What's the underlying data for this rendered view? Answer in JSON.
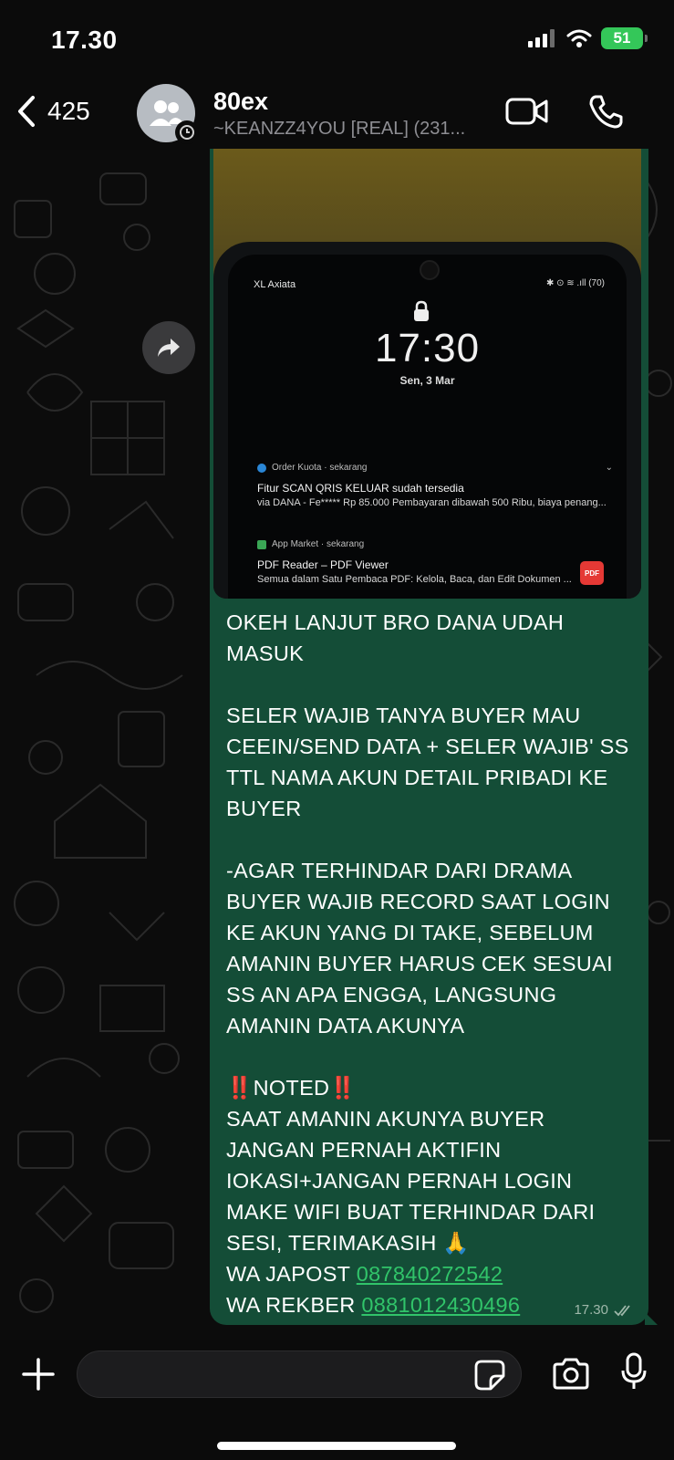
{
  "status_bar": {
    "time": "17.30",
    "battery": "51",
    "icons": [
      "signal-icon",
      "wifi-icon",
      "battery-icon"
    ]
  },
  "header": {
    "back_count": "425",
    "title": "80ex",
    "subtitle": "~KEANZZ4YOU [REAL] (231...",
    "icons": [
      "back-chevron-icon",
      "group-avatar-icon",
      "video-call-icon",
      "phone-call-icon"
    ]
  },
  "message": {
    "image": {
      "carrier": "XL Axiata",
      "status": "✱ ⊙ ≋ .ıll (70)",
      "lock_time": "17:30",
      "lock_date": "Sen, 3 Mar",
      "notifications": [
        {
          "app": "Order Kuota · sekarang",
          "title": "Fitur SCAN QRIS KELUAR sudah tersedia",
          "body": "via DANA - Fe***** Rp 85.000 Pembayaran dibawah 500 Ribu, biaya penang...",
          "color": "#2a86d6"
        },
        {
          "app": "App Market · sekarang",
          "title": "PDF Reader – PDF Viewer",
          "body": "Semua dalam Satu Pembaca PDF: Kelola, Baca, dan Edit Dokumen ...",
          "color": "#3aa655",
          "badge": "PDF"
        }
      ]
    },
    "text": {
      "p1": "OKEH LANJUT BRO DANA UDAH MASUK",
      "p2": "SELER WAJIB TANYA BUYER MAU CEEIN/SEND DATA + SELER WAJIB' SS TTL NAMA AKUN DETAIL PRIBADI KE BUYER",
      "p3": "-AGAR TERHINDAR DARI DRAMA BUYER WAJIB RECORD SAAT LOGIN KE AKUN YANG DI TAKE, SEBELUM AMANIN BUYER HARUS CEK SESUAI SS AN APA ENGGA, LANGSUNG AMANIN DATA AKUNYA",
      "noted_mark": "‼️",
      "noted": "NOTED",
      "p4": "SAAT AMANIN AKUNYA BUYER JANGAN PERNAH AKTIFIN IOKASI+JANGAN PERNAH LOGIN MAKE WIFI BUAT TERHINDAR DARI SESI, TERIMAKASIH 🙏",
      "wa_japost_label": "WA JAPOST",
      "wa_japost_number": "087840272542",
      "wa_rekber_label": "WA REKBER",
      "wa_rekber_number": "0881012430496"
    },
    "time": "17.30",
    "read_status": "delivered"
  },
  "input_bar": {
    "placeholder": "",
    "icons": [
      "plus-icon",
      "sticker-icon",
      "camera-icon",
      "microphone-icon"
    ]
  },
  "colors": {
    "bubble": "#144d37",
    "link": "#31c46a",
    "battery": "#34c759",
    "background": "#0c0c0c"
  }
}
